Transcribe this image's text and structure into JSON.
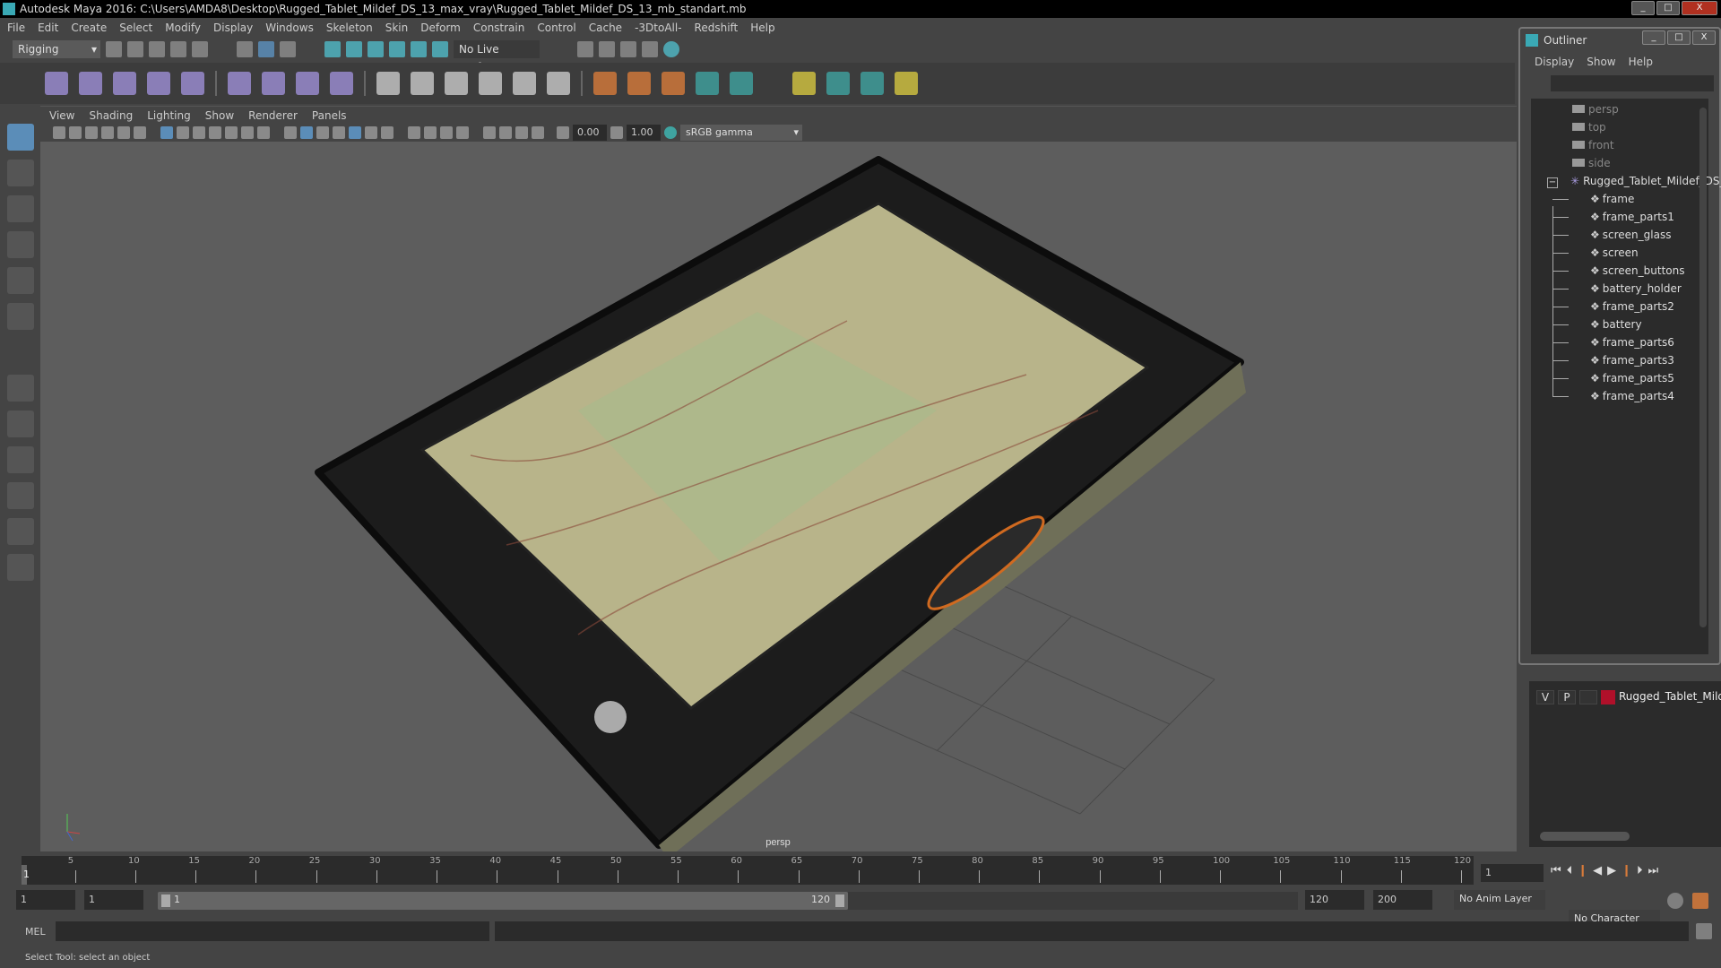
{
  "title": "Autodesk Maya 2016: C:\\Users\\AMDA8\\Desktop\\Rugged_Tablet_Mildef_DS_13_max_vray\\Rugged_Tablet_Mildef_DS_13_mb_standart.mb",
  "window_buttons": {
    "minimize": "_",
    "maximize": "□",
    "close": "X"
  },
  "menu": [
    "File",
    "Edit",
    "Create",
    "Select",
    "Modify",
    "Display",
    "Windows",
    "Skeleton",
    "Skin",
    "Deform",
    "Constrain",
    "Control",
    "Cache",
    "-3DtoAll-",
    "Redshift",
    "Help"
  ],
  "shelf": {
    "mode": "Rigging",
    "live_surface": "No Live Surface"
  },
  "panel_menu": [
    "View",
    "Shading",
    "Lighting",
    "Show",
    "Renderer",
    "Panels"
  ],
  "viewport_toolbar": {
    "exposure": "0.00",
    "gamma": "1.00",
    "color_space": "sRGB gamma"
  },
  "viewport": {
    "camera_label": "persp",
    "colors": {
      "background": "#5d5d5d",
      "tablet": "#1c1c1c",
      "bezel": "#6f6f58",
      "accent": "#d06a20"
    }
  },
  "outliner": {
    "title": "Outliner",
    "menu": [
      "Display",
      "Show",
      "Help"
    ],
    "cameras": [
      "persp",
      "top",
      "front",
      "side"
    ],
    "group": "Rugged_Tablet_Mildef_DS_",
    "children": [
      "frame",
      "frame_parts1",
      "screen_glass",
      "screen",
      "screen_buttons",
      "battery_holder",
      "frame_parts2",
      "battery",
      "frame_parts6",
      "frame_parts3",
      "frame_parts5",
      "frame_parts4"
    ]
  },
  "layer_editor": {
    "v": "V",
    "p": "P",
    "layer_name": "Rugged_Tablet_Mildef",
    "layer_color": "#b0102a"
  },
  "timeline": {
    "ticks": [
      5,
      10,
      15,
      20,
      25,
      30,
      35,
      40,
      45,
      50,
      55,
      60,
      65,
      70,
      75,
      80,
      85,
      90,
      95,
      100,
      105,
      110,
      115,
      120
    ],
    "current_frame": "1",
    "current_field": "1"
  },
  "range": {
    "start": "1",
    "start_inner": "1",
    "slider_start": "1",
    "slider_end": "120",
    "end_inner": "120",
    "end": "200",
    "anim_layer": "No Anim Layer",
    "character_set": "No Character Set"
  },
  "mel": {
    "label": "MEL"
  },
  "help_line": "Select Tool: select an object"
}
